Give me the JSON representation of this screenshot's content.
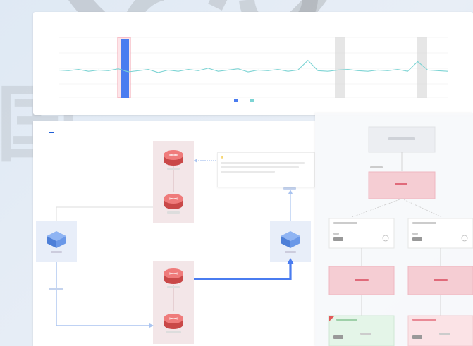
{
  "chart_panel": {
    "title": "",
    "subtitle": "",
    "toolbar": "",
    "legend": [
      {
        "label": "",
        "color": "#4a7cf0"
      },
      {
        "label": "",
        "color": "#7dd4d4"
      }
    ]
  },
  "chart_data": {
    "type": "line",
    "title": "",
    "xlabel": "",
    "ylabel": "",
    "series": [
      {
        "type": "bar",
        "values": [
          0,
          0,
          0,
          0,
          0,
          0,
          1,
          0,
          0,
          0,
          0,
          0,
          0,
          0,
          0,
          0,
          0,
          0,
          0,
          0,
          0,
          0,
          0,
          0,
          0,
          0,
          0,
          0,
          0,
          0,
          0,
          0,
          0,
          0,
          0,
          0,
          0,
          0,
          0,
          0
        ]
      },
      {
        "type": "line",
        "values": [
          0.46,
          0.45,
          0.47,
          0.44,
          0.46,
          0.45,
          0.48,
          0.43,
          0.45,
          0.47,
          0.42,
          0.46,
          0.44,
          0.47,
          0.45,
          0.49,
          0.44,
          0.46,
          0.48,
          0.43,
          0.46,
          0.45,
          0.47,
          0.44,
          0.46,
          0.62,
          0.45,
          0.44,
          0.46,
          0.47,
          0.45,
          0.44,
          0.46,
          0.45,
          0.47,
          0.44,
          0.6,
          0.46,
          0.45,
          0.44
        ]
      }
    ],
    "ylim": [
      0,
      1
    ]
  },
  "topology": {
    "tabs": [
      {
        "label": "",
        "active": false
      },
      {
        "label": "",
        "active": true,
        "badge": ""
      }
    ],
    "tooltip": {
      "title": ""
    }
  },
  "detail_panel": {
    "header": [
      "",
      ""
    ]
  },
  "colors": {
    "accent_blue": "#4a7cf0",
    "router_red": "#e25a5a",
    "switch_blue": "#5b8fe8",
    "pink_box": "#f3d3d8",
    "teal_line": "#7dd4d4"
  }
}
